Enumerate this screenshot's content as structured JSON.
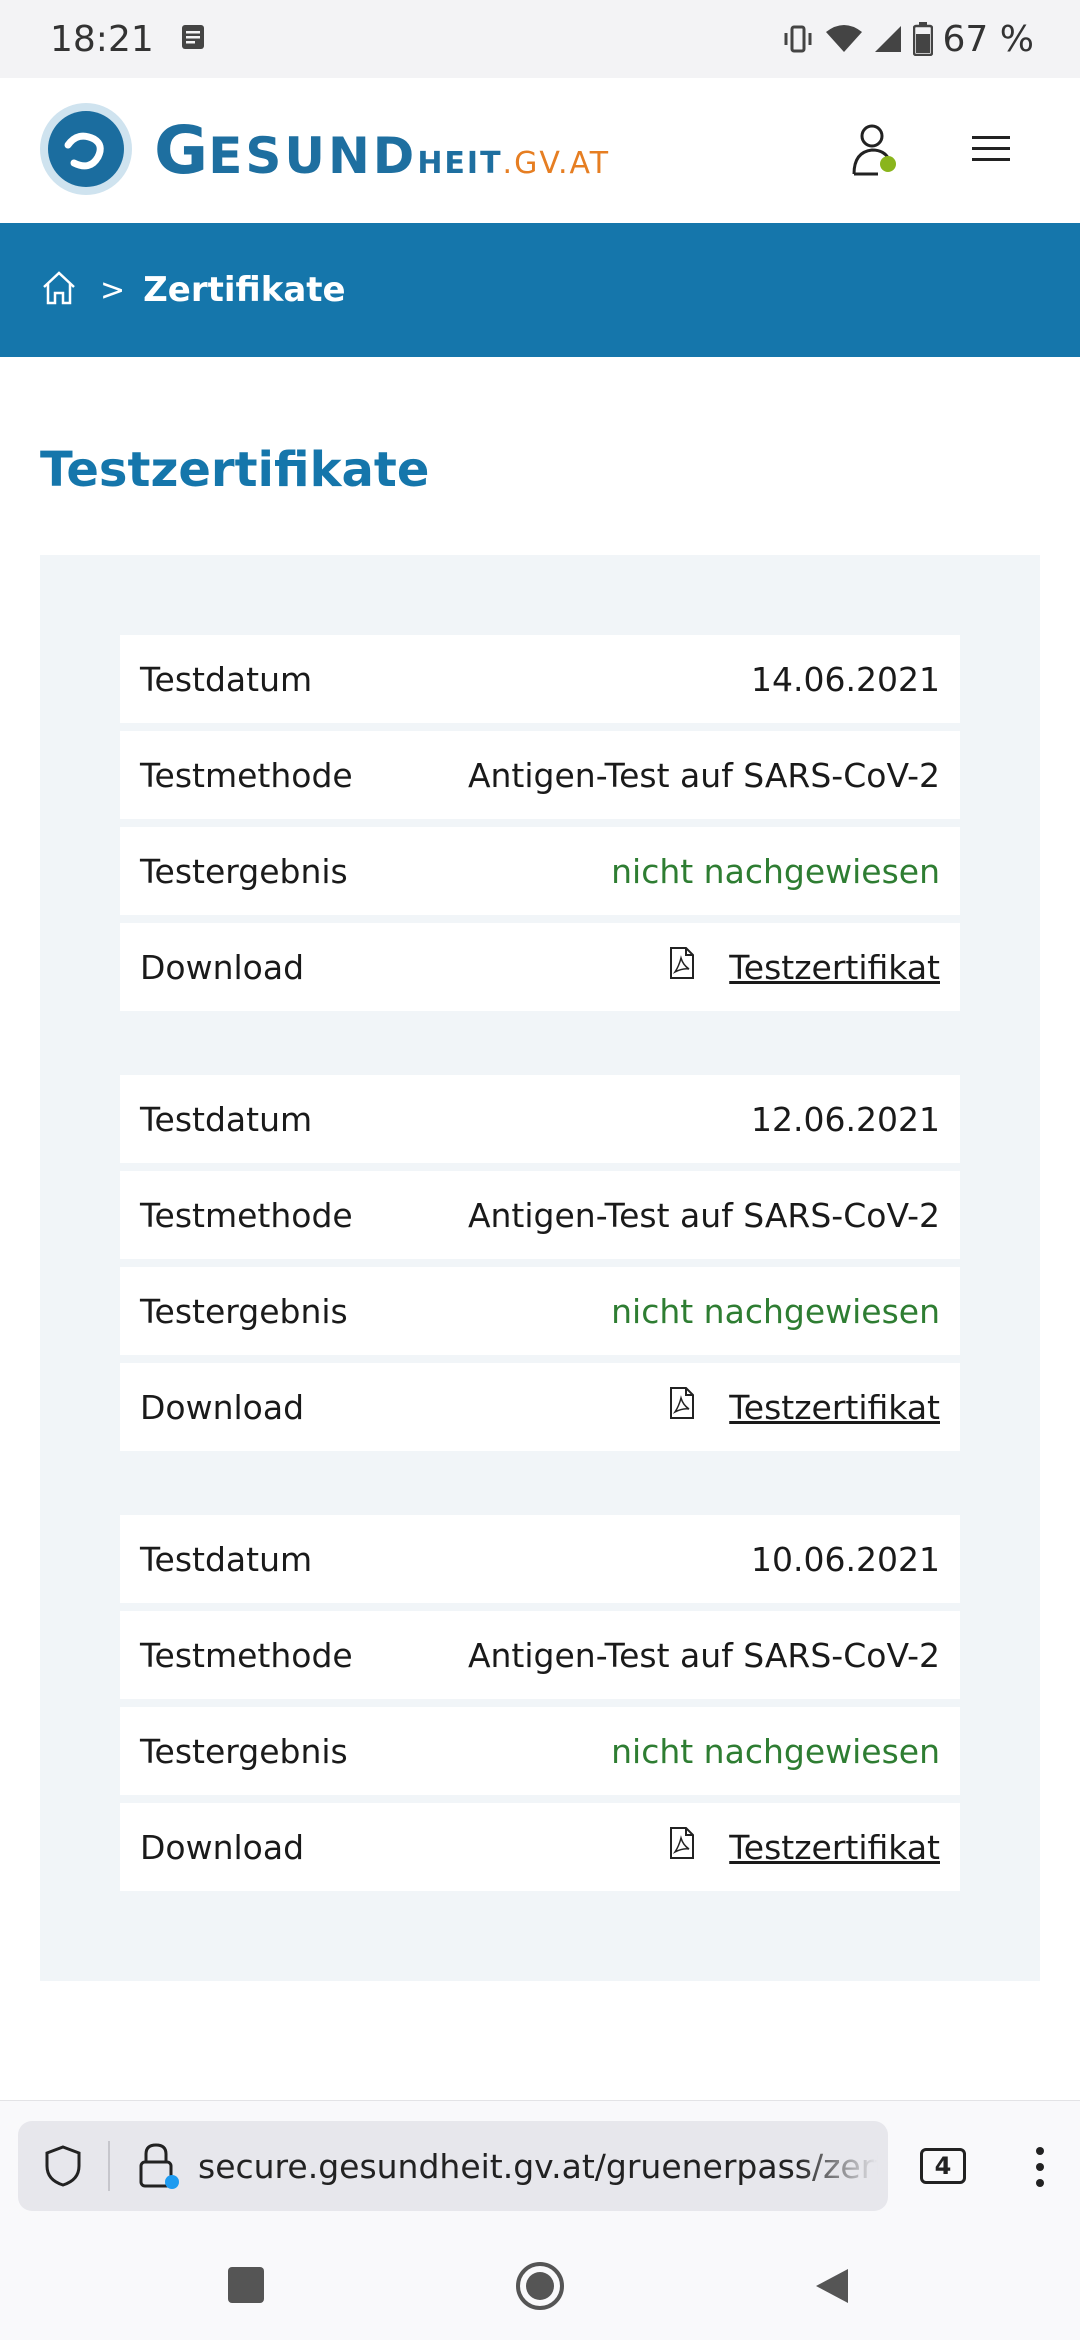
{
  "status_bar": {
    "time": "18:21",
    "battery": "67 %"
  },
  "header": {
    "logo": {
      "g": "G",
      "esund": "ESUND",
      "heit": "HEIT",
      "tld": ".GV.AT"
    }
  },
  "breadcrumb": {
    "separator": ">",
    "current": "Zertifikate"
  },
  "page": {
    "title": "Testzertifikate"
  },
  "labels": {
    "date": "Testdatum",
    "method": "Testmethode",
    "result": "Testergebnis",
    "download": "Download"
  },
  "certificates": [
    {
      "date": "14.06.2021",
      "method": "Antigen-Test auf SARS-CoV-2",
      "result": "nicht nachgewiesen",
      "download_link": "Testzertifikat"
    },
    {
      "date": "12.06.2021",
      "method": "Antigen-Test auf SARS-CoV-2",
      "result": "nicht nachgewiesen",
      "download_link": "Testzertifikat"
    },
    {
      "date": "10.06.2021",
      "method": "Antigen-Test auf SARS-CoV-2",
      "result": "nicht nachgewiesen",
      "download_link": "Testzertifikat"
    }
  ],
  "browser": {
    "url": "secure.gesundheit.gv.at/gruenerpass/zertifikate",
    "tab_count": "4"
  },
  "colors": {
    "brand_blue": "#1576ab",
    "result_green": "#2e7d32",
    "logo_orange": "#e67e22"
  }
}
